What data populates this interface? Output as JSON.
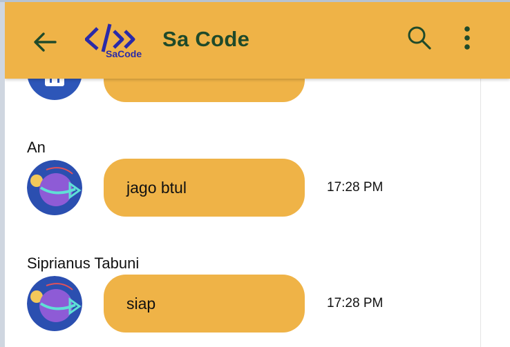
{
  "appbar": {
    "title": "Sa Code",
    "logo_text": "SaCode",
    "back_icon": "arrow-left-icon",
    "search_icon": "search-icon",
    "more_icon": "more-vertical-icon",
    "color": "#efb347",
    "title_color": "#1f4a2a"
  },
  "messages": [
    {
      "sender": "",
      "text": "",
      "time": ""
    },
    {
      "sender": "An",
      "text": "jago btul",
      "time": "17:28 PM"
    },
    {
      "sender": "Siprianus Tabuni",
      "text": "siap",
      "time": "17:28 PM"
    }
  ]
}
